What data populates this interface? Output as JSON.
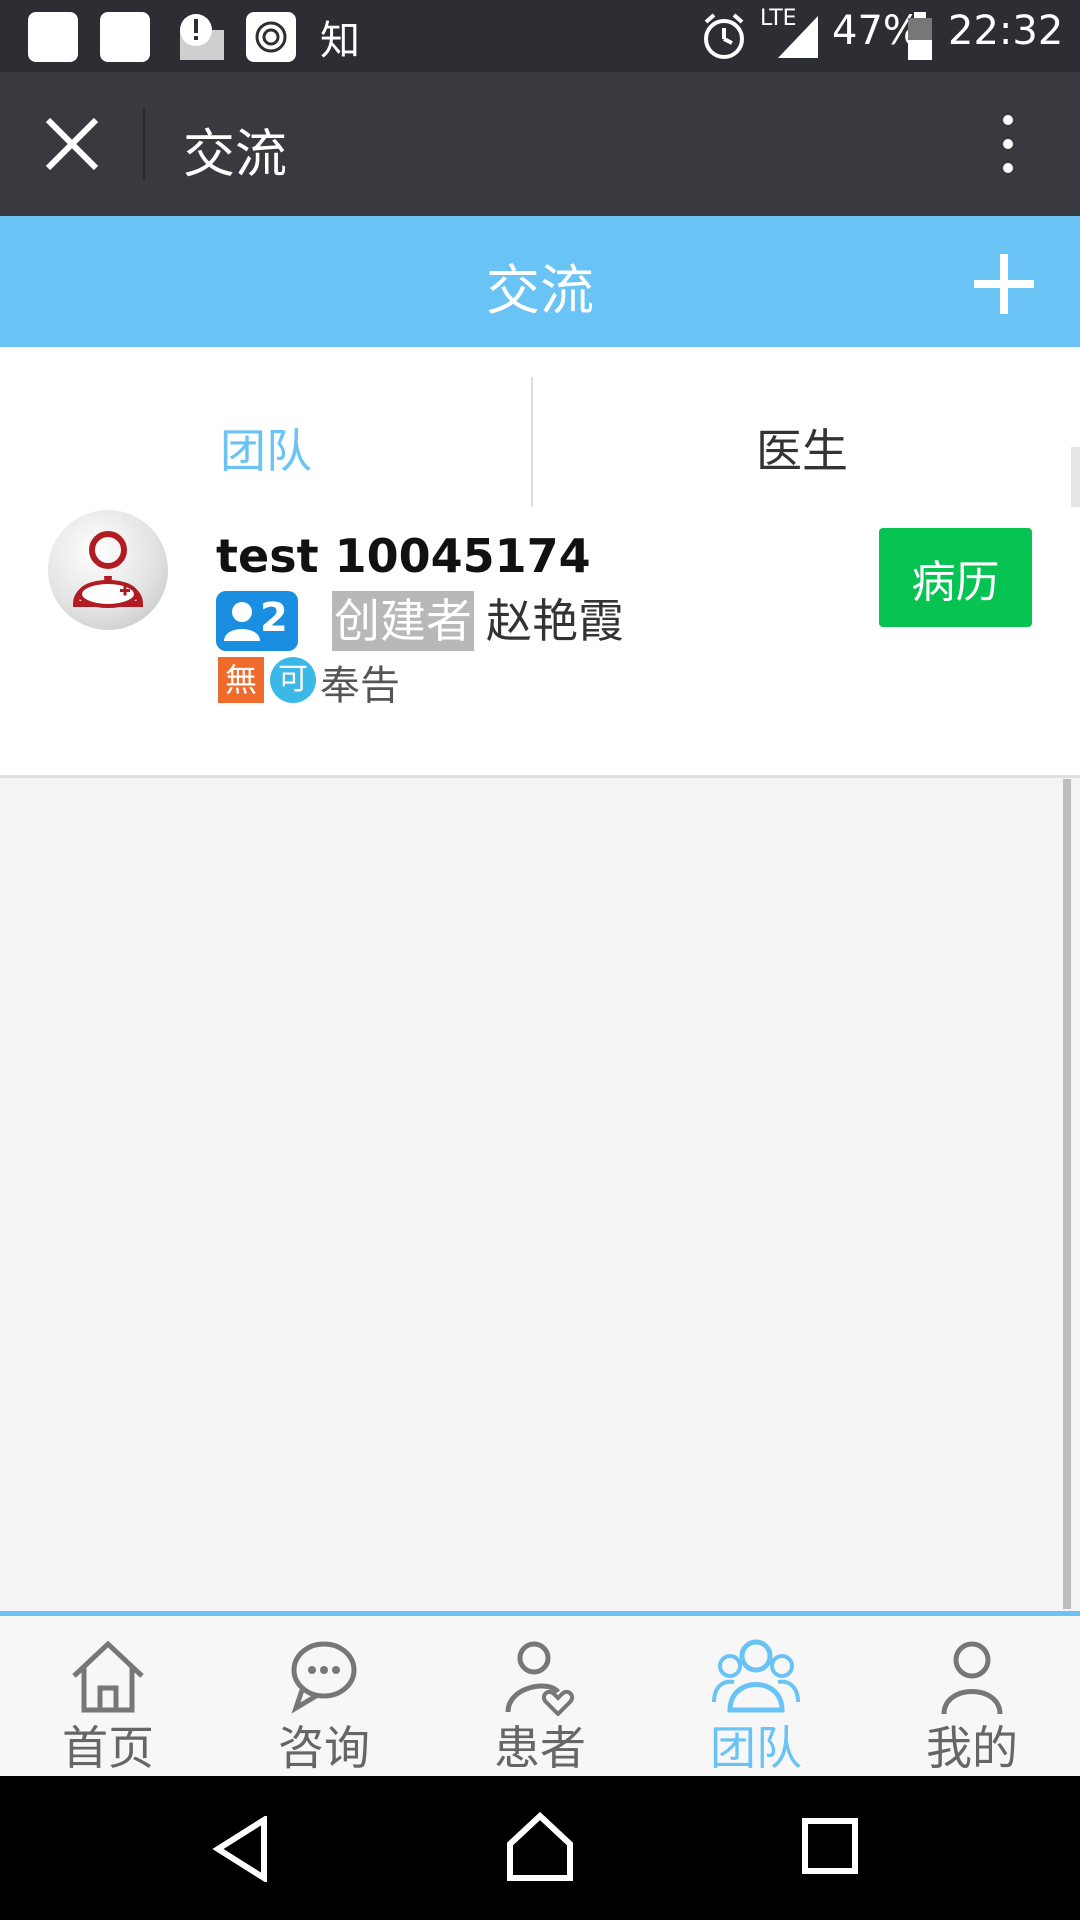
{
  "status_bar": {
    "app_glyph": "知",
    "network": "LTE",
    "battery": "47%",
    "time": "22:32"
  },
  "title_bar": {
    "title": "交流"
  },
  "header": {
    "title": "交流"
  },
  "tabs": [
    {
      "label": "团队",
      "active": true
    },
    {
      "label": "医生",
      "active": false
    }
  ],
  "team_card": {
    "name": "test 10045174",
    "member_count": "2",
    "creator_label": "创建者",
    "creator_name": "赵艳霞",
    "tag_wu": "無",
    "tag_ke": "可",
    "tag_text": "奉告",
    "record_button": "病历"
  },
  "bottom_nav": [
    {
      "label": "首页",
      "icon": "home-icon",
      "active": false
    },
    {
      "label": "咨询",
      "icon": "chat-icon",
      "active": false
    },
    {
      "label": "患者",
      "icon": "patient-icon",
      "active": false
    },
    {
      "label": "团队",
      "icon": "team-icon",
      "active": true
    },
    {
      "label": "我的",
      "icon": "profile-icon",
      "active": false
    }
  ],
  "colors": {
    "accent": "#6ac3f5",
    "record_button": "#06c352",
    "titlebar": "#393a3f",
    "statusbar": "#2c2e33"
  }
}
